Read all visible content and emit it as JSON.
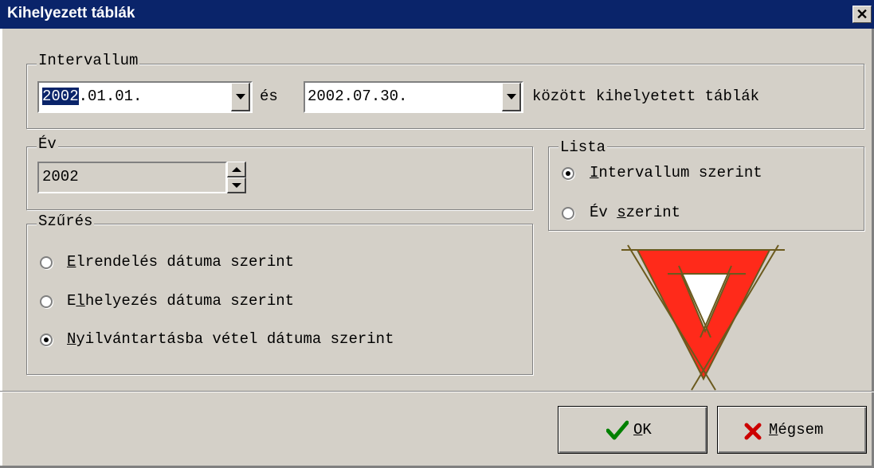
{
  "window": {
    "title": "Kihelyezett táblák",
    "close_glyph": "✕"
  },
  "intervallum": {
    "legend": "Intervallum",
    "from_selected": "2002",
    "from_rest": ".01.01.",
    "and_label": "és",
    "to_value": "2002.07.30.",
    "suffix": "között kihelyetett táblák"
  },
  "ev": {
    "legend": "Év",
    "value": "2002"
  },
  "lista": {
    "legend": "Lista",
    "options": [
      {
        "underline": "I",
        "rest": "ntervallum szerint",
        "selected": true
      },
      {
        "pre": "Év ",
        "underline": "s",
        "rest": "zerint",
        "selected": false
      }
    ]
  },
  "szures": {
    "legend": "Szűrés",
    "options": [
      {
        "underline": "E",
        "rest": "lrendelés dátuma szerint",
        "selected": false
      },
      {
        "pre": "E",
        "underline": "l",
        "rest": "helyezés dátuma szerint",
        "selected": false
      },
      {
        "underline": "N",
        "rest": "yilvántartásba vétel dátuma szerint",
        "selected": true
      }
    ]
  },
  "buttons": {
    "ok": {
      "underline": "O",
      "rest": "K",
      "icon": "checkmark-icon",
      "icon_color": "#008000"
    },
    "cancel": {
      "underline": "M",
      "rest": "égsem",
      "icon": "x-mark-icon",
      "icon_color": "#cc0000"
    }
  },
  "colors": {
    "titlebar": "#0a246a",
    "dialog": "#d4d0c8",
    "sign_red": "#ff2a1a"
  }
}
